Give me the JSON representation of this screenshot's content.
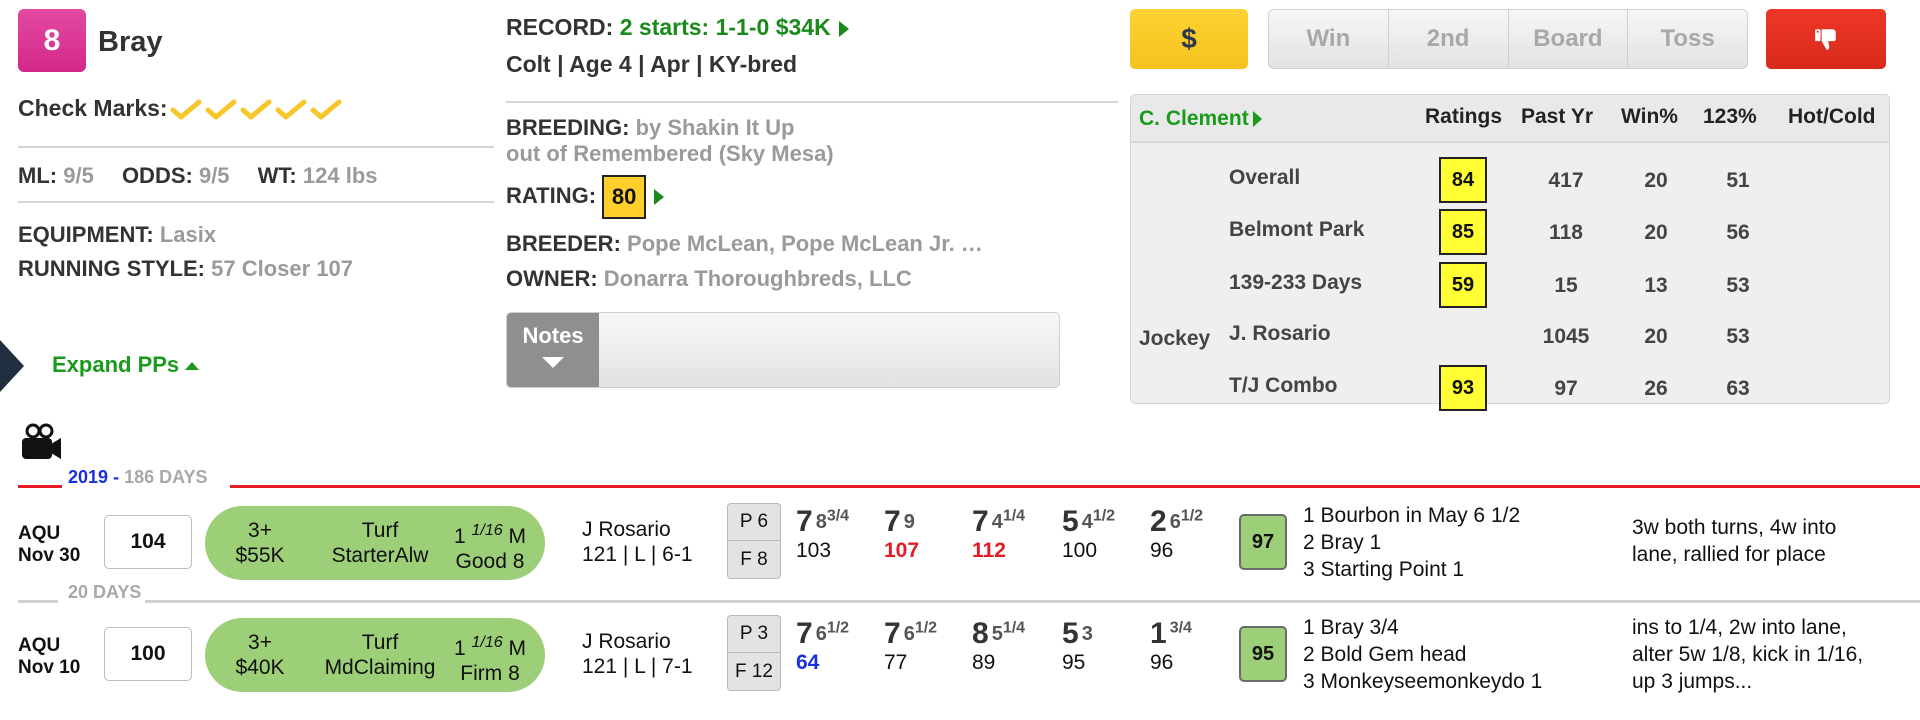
{
  "horse": {
    "post_position": "8",
    "post_color": "#d4288a",
    "name": "Bray",
    "check_marks_label": "Check Marks:",
    "check_marks_count": 5,
    "ml_label": "ML:",
    "ml_value": "9/5",
    "odds_label": "ODDS:",
    "odds_value": "9/5",
    "wt_label": "WT:",
    "wt_value": "124 lbs",
    "equipment_label": "EQUIPMENT:",
    "equipment_value": "Lasix",
    "running_style_label": "RUNNING STYLE:",
    "running_style_value": "57 Closer 107",
    "expand_label": "Expand PPs"
  },
  "details": {
    "record_label": "RECORD:",
    "record_value": "2 starts: 1-1-0 $34K",
    "profile": "Colt | Age 4 | Apr | KY-bred",
    "breeding_label": "BREEDING:",
    "breeding_line1": "by Shakin It Up",
    "breeding_line2": "out of Remembered (Sky Mesa)",
    "rating_label": "RATING:",
    "rating_value": "80",
    "breeder_label": "BREEDER:",
    "breeder_value": "Pope McLean, Pope McLean Jr. …",
    "owner_label": "OWNER:",
    "owner_value": "Donarra Thoroughbreds, LLC",
    "notes_label": "Notes"
  },
  "actions": {
    "dollar_label": "$",
    "segments": [
      "Win",
      "2nd",
      "Board",
      "Toss"
    ],
    "thumb_icon": "thumbs-down-icon"
  },
  "trainer_panel": {
    "trainer_name": "C. Clement",
    "headers": [
      "Ratings",
      "Past Yr",
      "Win%",
      "123%",
      "Hot/Cold"
    ],
    "rows": [
      {
        "group": "",
        "label": "Overall",
        "rating": "84",
        "past_yr": "417",
        "win_pct": "20",
        "itm_pct": "51",
        "hot_cold": ""
      },
      {
        "group": "",
        "label": "Belmont Park",
        "rating": "85",
        "past_yr": "118",
        "win_pct": "20",
        "itm_pct": "56",
        "hot_cold": ""
      },
      {
        "group": "",
        "label": "139-233 Days",
        "rating": "59",
        "past_yr": "15",
        "win_pct": "13",
        "itm_pct": "53",
        "hot_cold": ""
      },
      {
        "group": "Jockey",
        "label": "J. Rosario",
        "rating": "",
        "past_yr": "1045",
        "win_pct": "20",
        "itm_pct": "53",
        "hot_cold": ""
      },
      {
        "group": "",
        "label": "T/J Combo",
        "rating": "93",
        "past_yr": "97",
        "win_pct": "26",
        "itm_pct": "63",
        "hot_cold": ""
      }
    ]
  },
  "pp": {
    "year": "2019",
    "year_dash": "-",
    "days_since": "186 DAYS",
    "gap_label": "20 DAYS",
    "races": [
      {
        "track": "AQU",
        "date": "Nov 30",
        "figure": "104",
        "age": "3+",
        "purse": "$55K",
        "surface": "Turf",
        "race_type": "StarterAlw",
        "distance_whole": "1",
        "distance_frac": "1/16",
        "distance_unit": "M",
        "condition": "Good 8",
        "jockey": "J Rosario",
        "jockey_line2": "121 | L | 6-1",
        "post": "P 6",
        "field": "F 8",
        "calls": [
          {
            "pos": "7",
            "len": "8",
            "frac": "3/4",
            "speed": "103",
            "speed_color": "normal"
          },
          {
            "pos": "7",
            "len": "9",
            "frac": "",
            "speed": "107",
            "speed_color": "red"
          },
          {
            "pos": "7",
            "len": "4",
            "frac": "1/4",
            "speed": "112",
            "speed_color": "red"
          },
          {
            "pos": "5",
            "len": "4",
            "frac": "1/2",
            "speed": "100",
            "speed_color": "normal"
          },
          {
            "pos": "2",
            "len": "6",
            "frac": "1/2",
            "speed": "96",
            "speed_color": "normal"
          }
        ],
        "speed_rating": "97",
        "finishers": [
          "1 Bourbon in May 6 1/2",
          "2 Bray 1",
          "3 Starting Point 1"
        ],
        "comment": "3w both turns, 4w into lane, rallied for place"
      },
      {
        "track": "AQU",
        "date": "Nov 10",
        "figure": "100",
        "age": "3+",
        "purse": "$40K",
        "surface": "Turf",
        "race_type": "MdClaiming",
        "distance_whole": "1",
        "distance_frac": "1/16",
        "distance_unit": "M",
        "condition": "Firm 8",
        "jockey": "J Rosario",
        "jockey_line2": "121 | L | 7-1",
        "post": "P 3",
        "field": "F 12",
        "calls": [
          {
            "pos": "7",
            "len": "6",
            "frac": "1/2",
            "speed": "64",
            "speed_color": "blue"
          },
          {
            "pos": "7",
            "len": "6",
            "frac": "1/2",
            "speed": "77",
            "speed_color": "normal"
          },
          {
            "pos": "8",
            "len": "5",
            "frac": "1/4",
            "speed": "89",
            "speed_color": "normal"
          },
          {
            "pos": "5",
            "len": "3",
            "frac": "",
            "speed": "95",
            "speed_color": "normal"
          },
          {
            "pos": "1",
            "len": "",
            "frac": "3/4",
            "speed": "96",
            "speed_color": "normal"
          }
        ],
        "speed_rating": "95",
        "finishers": [
          "1 Bray 3/4",
          "2 Bold Gem head",
          "3 Monkeyseemonkeydo 1"
        ],
        "comment": "ins to 1/4, 2w into lane, alter 5w 1/8, kick in 1/16, up 3 jumps..."
      }
    ]
  }
}
